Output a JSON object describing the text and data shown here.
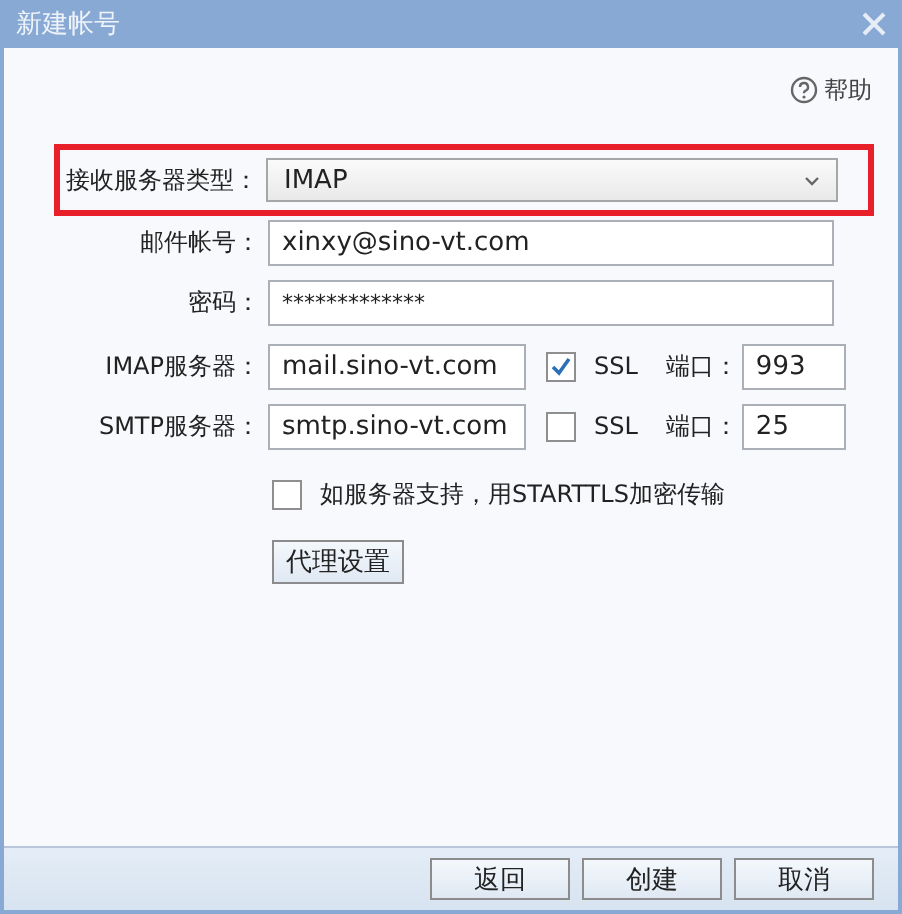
{
  "window": {
    "title": "新建帐号"
  },
  "help": {
    "label": "帮助"
  },
  "server_type": {
    "label": "接收服务器类型：",
    "value": "IMAP",
    "highlighted": true
  },
  "email": {
    "label": "邮件帐号：",
    "value": "xinxy@sino-vt.com"
  },
  "password": {
    "label": "密码：",
    "value": "*************"
  },
  "servers": [
    {
      "label": "IMAP服务器：",
      "value": "mail.sino-vt.com",
      "ssl_label": "SSL",
      "ssl_checked": true,
      "port_label": "端口：",
      "port": "993"
    },
    {
      "label": "SMTP服务器：",
      "value": "smtp.sino-vt.com",
      "ssl_label": "SSL",
      "ssl_checked": false,
      "port_label": "端口：",
      "port": "25"
    }
  ],
  "starttls": {
    "label": "如服务器支持，用STARTTLS加密传输",
    "checked": false
  },
  "proxy_button": "代理设置",
  "buttons": [
    "返回",
    "创建",
    "取消"
  ]
}
